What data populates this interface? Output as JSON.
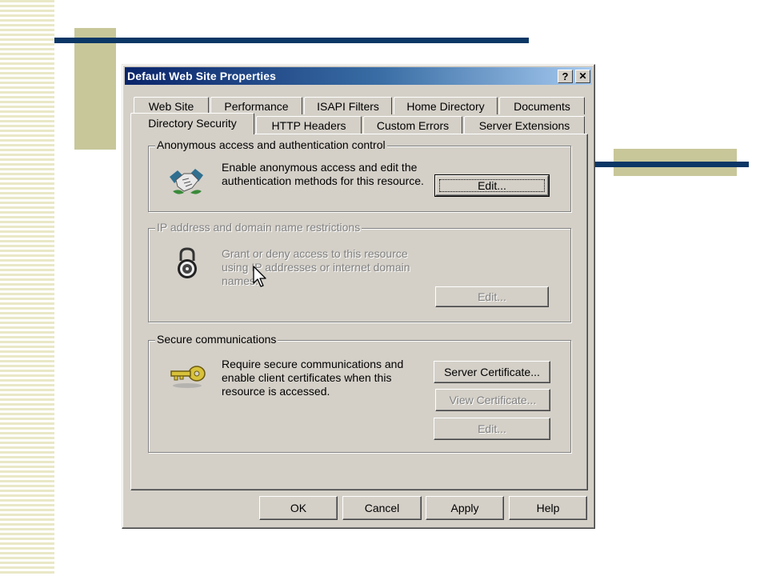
{
  "window": {
    "title": "Default Web Site Properties",
    "help_label": "?",
    "close_label": "✕"
  },
  "tabs": {
    "row1": [
      "Web Site",
      "Performance",
      "ISAPI Filters",
      "Home Directory",
      "Documents"
    ],
    "row2": [
      "Directory Security",
      "HTTP Headers",
      "Custom Errors",
      "Server Extensions"
    ],
    "active": "Directory Security"
  },
  "groups": {
    "anonymous": {
      "label": "Anonymous access and authentication control",
      "text": "Enable anonymous access and edit the authentication methods for this resource.",
      "edit_label": "Edit...",
      "icon": "handshake-icon"
    },
    "ip": {
      "label": "IP address and domain name restrictions",
      "text": "Grant or deny access to this resource using IP addresses or internet domain names.",
      "edit_label": "Edit...",
      "icon": "padlock-icon"
    },
    "secure": {
      "label": "Secure communications",
      "text": "Require secure communications and enable client certificates when this resource is accessed.",
      "server_cert_label": "Server Certificate...",
      "view_cert_label": "View Certificate...",
      "edit_label": "Edit...",
      "icon": "key-icon"
    }
  },
  "footer": {
    "ok_label": "OK",
    "cancel_label": "Cancel",
    "apply_label": "Apply",
    "help_label": "Help"
  },
  "colors": {
    "navy": "#0b3766",
    "olive": "#c8c79a",
    "face": "#d4d0c8"
  }
}
